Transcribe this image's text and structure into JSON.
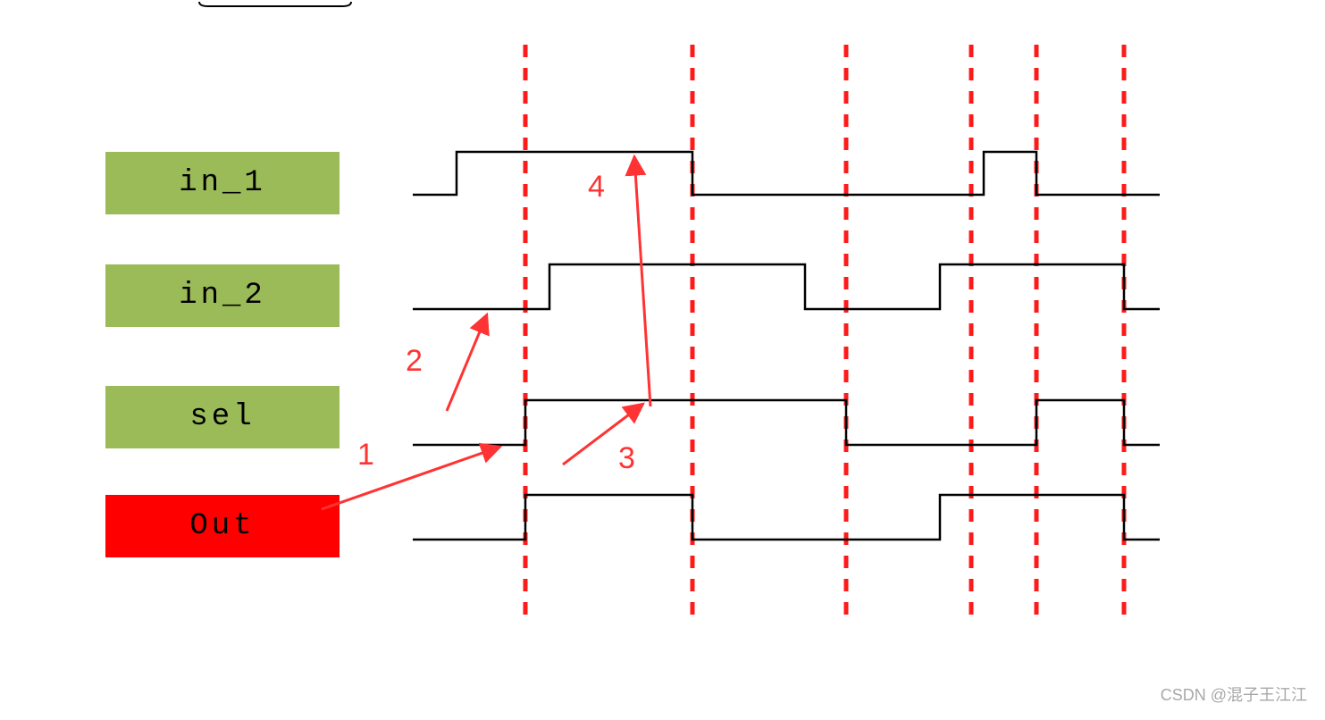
{
  "labels": {
    "in1": "in_1",
    "in2": "in_2",
    "sel": "sel",
    "out": "Out"
  },
  "annotations": {
    "a1": "1",
    "a2": "2",
    "a3": "3",
    "a4": "4"
  },
  "watermark": "CSDN @混子王江江",
  "colors": {
    "green": "#9bbb59",
    "red": "#ff0000",
    "anno_red": "#ff3333",
    "wave_black": "#000000"
  },
  "chart_data": {
    "type": "timing-diagram",
    "time_units": 17,
    "guideline_positions": [
      2.5,
      6.25,
      9.75,
      12.5,
      14.0,
      16.0
    ],
    "signals": [
      {
        "name": "in_1",
        "transitions": "L(0-1) H(1-6.25) L(6.25-13) H(13-14) L(14-17)"
      },
      {
        "name": "in_2",
        "transitions": "L(0-3) H(3-9) L(9-12) H(12-16) L(16-17)"
      },
      {
        "name": "sel",
        "transitions": "L(0-2.5) H(2.5-9.75) L(9.75-14) H(14-16) L(16-17)"
      },
      {
        "name": "Out",
        "transitions": "L(0-2.5) H(2.5-6.25) L(6.25-12) H(12-16) L(16-17)"
      }
    ],
    "annotation_arrows": [
      {
        "label": "1",
        "from": "Out label",
        "to": "sel low segment"
      },
      {
        "label": "2",
        "from": "near sel",
        "to": "in_2 low segment"
      },
      {
        "label": "3",
        "from": "near sel",
        "to": "sel high segment"
      },
      {
        "label": "4",
        "from": "near in_1",
        "to": "in_1 high segment going up"
      }
    ]
  }
}
